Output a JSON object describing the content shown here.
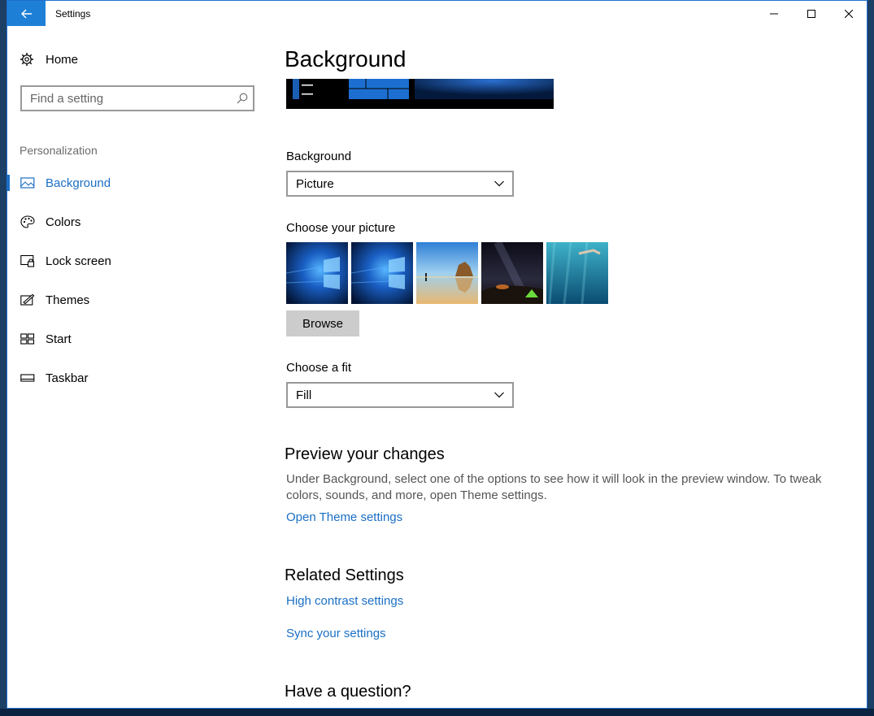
{
  "window": {
    "title": "Settings"
  },
  "sidebar": {
    "home_label": "Home",
    "search_placeholder": "Find a setting",
    "section_label": "Personalization",
    "items": [
      {
        "label": "Background",
        "icon": "picture-icon",
        "active": true
      },
      {
        "label": "Colors",
        "icon": "palette-icon",
        "active": false
      },
      {
        "label": "Lock screen",
        "icon": "lock-screen-icon",
        "active": false
      },
      {
        "label": "Themes",
        "icon": "themes-icon",
        "active": false
      },
      {
        "label": "Start",
        "icon": "start-icon",
        "active": false
      },
      {
        "label": "Taskbar",
        "icon": "taskbar-icon",
        "active": false
      }
    ]
  },
  "main": {
    "title": "Background",
    "background_label": "Background",
    "background_value": "Picture",
    "choose_picture_label": "Choose your picture",
    "browse_label": "Browse",
    "choose_fit_label": "Choose a fit",
    "fit_value": "Fill",
    "preview_heading": "Preview your changes",
    "preview_text": "Under Background, select one of the options to see how it will look in the preview window. To tweak colors, sounds, and more, open Theme settings.",
    "open_theme_link": "Open Theme settings",
    "related_heading": "Related Settings",
    "high_contrast_link": "High contrast settings",
    "sync_link": "Sync your settings",
    "question_heading": "Have a question?"
  },
  "colors": {
    "accent": "#1a6fc4",
    "back_button": "#1e7fd6"
  }
}
